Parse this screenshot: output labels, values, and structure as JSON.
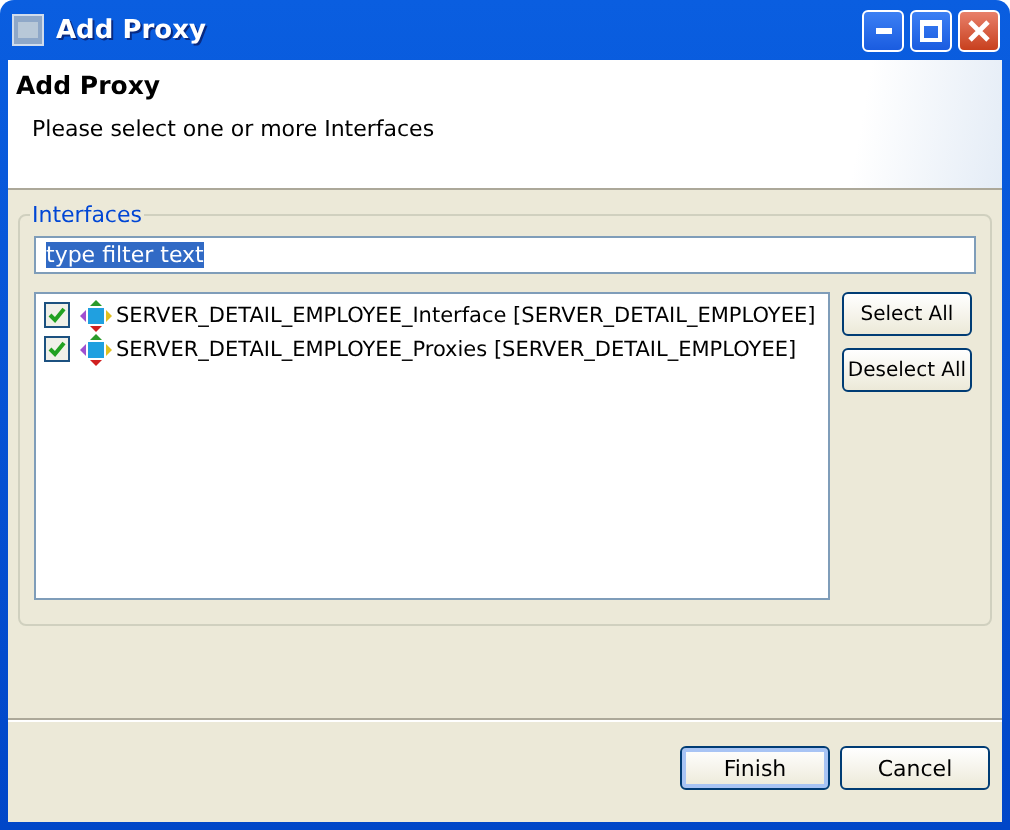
{
  "window": {
    "title": "Add Proxy"
  },
  "header": {
    "title": "Add Proxy",
    "message": "Please select one or more Interfaces"
  },
  "group": {
    "label": "Interfaces",
    "filter": {
      "value": "type filter text",
      "selected": true
    },
    "items": [
      {
        "label": "SERVER_DETAIL_EMPLOYEE_Interface [SERVER_DETAIL_EMPLOYEE]",
        "checked": true
      },
      {
        "label": "SERVER_DETAIL_EMPLOYEE_Proxies [SERVER_DETAIL_EMPLOYEE]",
        "checked": true
      }
    ],
    "buttons": [
      "Select All",
      "Deselect All"
    ]
  },
  "buttons": [
    {
      "label": "Finish",
      "default": true
    },
    {
      "label": "Cancel",
      "default": false
    }
  ]
}
